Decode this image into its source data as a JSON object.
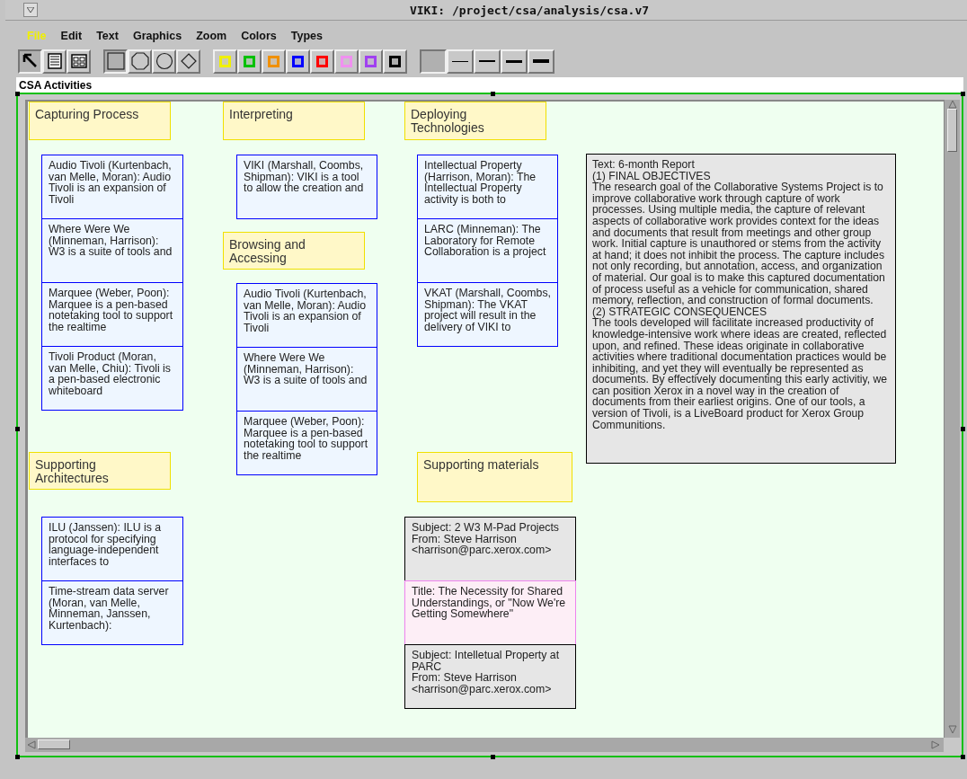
{
  "window": {
    "title": "VIKI: /project/csa/analysis/csa.v7"
  },
  "menu": [
    {
      "label": "File",
      "selected": true
    },
    {
      "label": "Edit",
      "selected": false
    },
    {
      "label": "Text",
      "selected": false
    },
    {
      "label": "Graphics",
      "selected": false
    },
    {
      "label": "Zoom",
      "selected": false
    },
    {
      "label": "Colors",
      "selected": false
    },
    {
      "label": "Types",
      "selected": false
    }
  ],
  "toolbar": {
    "tools": [
      {
        "kind": "pointer",
        "selected": true
      },
      {
        "kind": "text",
        "selected": false
      },
      {
        "kind": "collection",
        "selected": false
      }
    ],
    "shapes": [
      {
        "kind": "rectangle",
        "selected": true
      },
      {
        "kind": "octagon",
        "selected": false
      },
      {
        "kind": "circle",
        "selected": false
      },
      {
        "kind": "diamond",
        "selected": false
      }
    ],
    "colors": [
      {
        "color": "#f0f000",
        "selected": false
      },
      {
        "color": "#00c000",
        "selected": false
      },
      {
        "color": "#f09000",
        "selected": false
      },
      {
        "color": "#0000ff",
        "selected": false
      },
      {
        "color": "#ff0000",
        "selected": false
      },
      {
        "color": "#f090f0",
        "selected": false
      },
      {
        "color": "#a040f0",
        "selected": false
      },
      {
        "color": "#000000",
        "selected": false
      }
    ],
    "lines": [
      {
        "kind": "none",
        "selected": true
      },
      {
        "kind": "thin",
        "selected": false
      },
      {
        "kind": "medium",
        "selected": false
      },
      {
        "kind": "thick",
        "selected": false
      },
      {
        "kind": "thicker",
        "selected": false
      }
    ]
  },
  "collection": {
    "title": "CSA Activities",
    "objects": [
      {
        "kind": "heading",
        "text": "Capturing Process"
      },
      {
        "kind": "stack",
        "cards": [
          {
            "color": "#0000ff",
            "text": "Audio Tivoli (Kurtenbach, van Melle, Moran):  Audio Tivoli is an expansion of Tivoli"
          },
          {
            "color": "#0000ff",
            "text": "Where Were We (Minneman,  Harrison): W3 is a suite of tools and"
          },
          {
            "color": "#0000ff",
            "text": "Marquee (Weber, Poon): Marquee is a pen-based notetaking tool to support the realtime"
          },
          {
            "color": "#0000ff",
            "text": "Tivoli Product (Moran, van Melle, Chiu): Tivoli is a pen-based electronic whiteboard"
          }
        ]
      },
      {
        "kind": "heading",
        "text": "Interpreting"
      },
      {
        "kind": "stack",
        "cards": [
          {
            "color": "#0000ff",
            "text": "VIKI (Marshall, Coombs, Shipman):  VIKI is a tool to allow the creation and"
          }
        ]
      },
      {
        "kind": "heading",
        "text": "Browsing and Accessing"
      },
      {
        "kind": "stack",
        "cards": [
          {
            "color": "#0000ff",
            "text": "Audio Tivoli (Kurtenbach, van Melle, Moran):  Audio Tivoli is an expansion of Tivoli"
          },
          {
            "color": "#0000ff",
            "text": "Where Were We (Minneman,  Harrison): W3 is a suite of tools and"
          },
          {
            "color": "#0000ff",
            "text": "Marquee (Weber, Poon): Marquee is a pen-based notetaking tool to support the realtime"
          }
        ]
      },
      {
        "kind": "heading",
        "text": "Deploying Technologies"
      },
      {
        "kind": "stack",
        "cards": [
          {
            "color": "#0000ff",
            "text": "Intellectual Property (Harrison, Moran):  The Intellectual Property activity is both to"
          },
          {
            "color": "#0000ff",
            "text": "LARC (Minneman): The Laboratory for Remote Collaboration is a project"
          },
          {
            "color": "#0000ff",
            "text": "VKAT (Marshall, Coombs, Shipman): The VKAT project will result in the delivery of VIKI to"
          }
        ]
      },
      {
        "kind": "note",
        "color": "#000000",
        "lines": [
          "Text: 6-month Report",
          "(1) FINAL OBJECTIVES",
          "The research goal of the Collaborative Systems Project is to improve collaborative work through capture of work processes. Using multiple media, the capture of relevant aspects of collaborative work provides context for the ideas and documents that result from meetings and other group work. Initial capture is unauthored or stems from the activity at hand; it does not inhibit the process. The capture includes not only recording, but annotation, access, and organization of material. Our goal is to make this captured documentation of process useful as a vehicle for communication, shared memory, reflection, and construction of formal documents.",
          "(2) STRATEGIC CONSEQUENCES",
          "The tools developed will facilitate increased productivity of knowledge-intensive work where ideas are created, reflected upon, and refined. These ideas originate in collaborative activities where traditional documentation practices would be inhibiting, and yet they will eventually be represented as documents. By effectively documenting this early activitiy, we can position Xerox in a novel way in the creation of documents from their earliest origins. One of our tools, a version of Tivoli, is a LiveBoard product for Xerox Group Communitions."
        ]
      },
      {
        "kind": "heading",
        "text": "Supporting Architectures"
      },
      {
        "kind": "stack",
        "cards": [
          {
            "color": "#0000ff",
            "text": "ILU (Janssen): ILU is a protocol for specifying language-independent interfaces to"
          },
          {
            "color": "#0000ff",
            "text": "Time-stream data server (Moran, van Melle, Minneman, Janssen, Kurtenbach):"
          }
        ]
      },
      {
        "kind": "heading",
        "text": "Supporting materials"
      },
      {
        "kind": "stack",
        "cards": [
          {
            "color": "#000000",
            "text": "Subject: 2 W3 M-Pad Projects\nFrom: Steve Harrison <harrison@parc.xerox.com>"
          },
          {
            "color": "#ee82ee",
            "text": "Title:  The Necessity for Shared Understandings, or \"Now We're Getting Somewhere\""
          },
          {
            "color": "#000000",
            "text": "Subject: Intelletual Property at PARC\nFrom: Steve Harrison <harrison@parc.xerox.com>"
          }
        ]
      }
    ]
  }
}
